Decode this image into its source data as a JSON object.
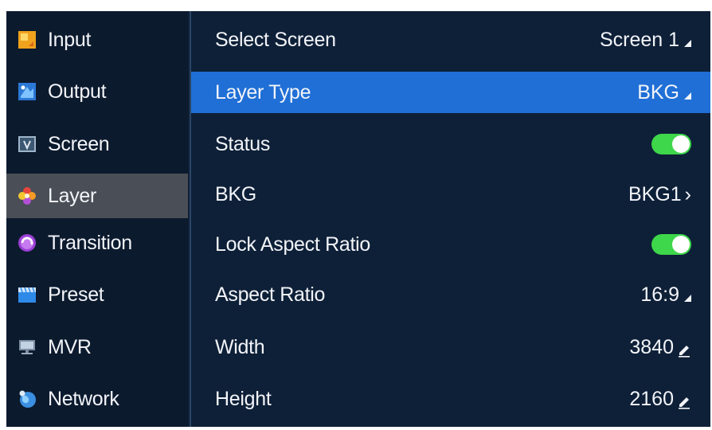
{
  "sidebar": {
    "items": [
      {
        "label": "Input",
        "icon": "input-icon"
      },
      {
        "label": "Output",
        "icon": "output-icon"
      },
      {
        "label": "Screen",
        "icon": "screen-icon"
      },
      {
        "label": "Layer",
        "icon": "layer-icon",
        "active": true
      },
      {
        "label": "Transition",
        "icon": "transition-icon"
      },
      {
        "label": "Preset",
        "icon": "preset-icon"
      },
      {
        "label": "MVR",
        "icon": "mvr-icon"
      },
      {
        "label": "Network",
        "icon": "network-icon"
      }
    ]
  },
  "settings": {
    "select_screen": {
      "label": "Select Screen",
      "value": "Screen 1"
    },
    "layer_type": {
      "label": "Layer Type",
      "value": "BKG",
      "selected": true
    },
    "status": {
      "label": "Status",
      "enabled": true
    },
    "bkg": {
      "label": "BKG",
      "value": "BKG1"
    },
    "lock_aspect_ratio": {
      "label": "Lock Aspect Ratio",
      "enabled": true
    },
    "aspect_ratio": {
      "label": "Aspect Ratio",
      "value": "16:9"
    },
    "width": {
      "label": "Width",
      "value": "3840"
    },
    "height": {
      "label": "Height",
      "value": "2160"
    }
  },
  "colors": {
    "selected_row": "#1f6fd6",
    "toggle_on": "#3ed64a",
    "background": "#0e2038",
    "active_sidebar": "#4a4f57"
  }
}
